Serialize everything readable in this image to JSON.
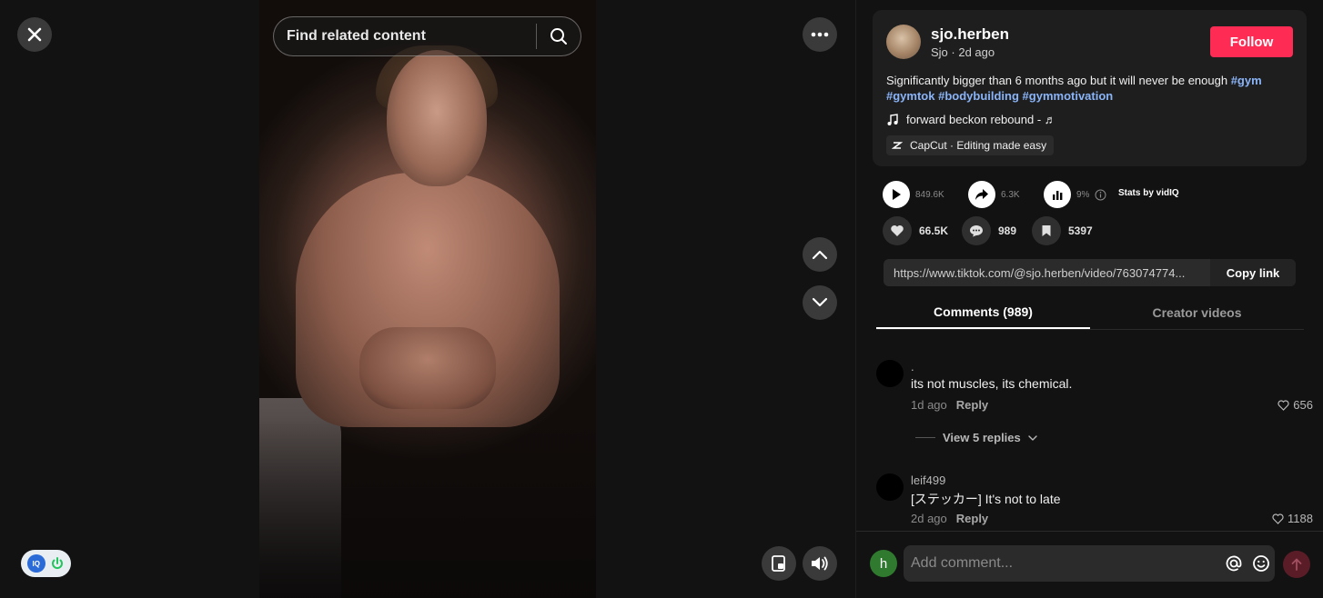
{
  "search": {
    "placeholder": "Find related content"
  },
  "author": {
    "username": "sjo.herben",
    "meta": "Sjo · 2d ago",
    "follow_label": "Follow"
  },
  "post": {
    "description": "Significantly bigger than 6 months ago but it will never be enough ",
    "hashtags": [
      "#gym",
      "#gymtok",
      "#bodybuilding",
      "#gymmotivation"
    ],
    "music": "forward beckon rebound - ♬",
    "capcut": "CapCut · Editing made easy"
  },
  "stats": {
    "views": "849.6K",
    "shares": "6.3K",
    "percent": "9%",
    "vidiq_label": "Stats by vidIQ"
  },
  "actions": {
    "likes": "66.5K",
    "comments": "989",
    "saves": "5397"
  },
  "link": {
    "url": "https://www.tiktok.com/@sjo.herben/video/763074774...",
    "copy_label": "Copy link"
  },
  "tabs": [
    {
      "label": "Comments (989)"
    },
    {
      "label": "Creator videos"
    }
  ],
  "comments": [
    {
      "username": ".",
      "text": "its not muscles, its chemical.",
      "time": "1d ago",
      "reply": "Reply",
      "likes": "656",
      "view_replies": "View 5 replies"
    },
    {
      "username": "leif499",
      "text": "[ステッカー] It's not to late",
      "time": "2d ago",
      "reply": "Reply",
      "likes": "1188"
    }
  ],
  "composer": {
    "initial": "h",
    "placeholder": "Add comment..."
  },
  "colors": {
    "accent": "#fe2c55",
    "hashtag": "#8ab4f8"
  }
}
